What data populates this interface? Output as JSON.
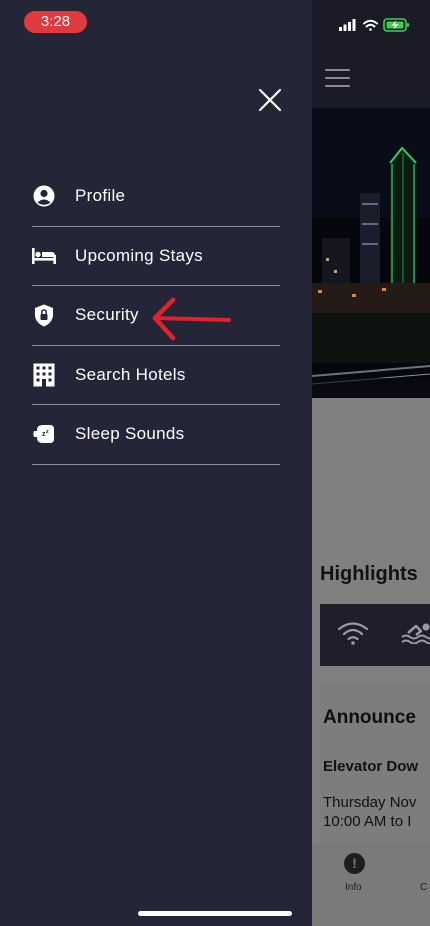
{
  "status_bar": {
    "time": "3:28"
  },
  "drawer": {
    "menu": [
      {
        "label": "Profile",
        "icon": "profile-icon"
      },
      {
        "label": "Upcoming Stays",
        "icon": "bed-icon"
      },
      {
        "label": "Security",
        "icon": "shield-lock-icon"
      },
      {
        "label": "Search Hotels",
        "icon": "building-icon"
      },
      {
        "label": "Sleep Sounds",
        "icon": "sleep-sounds-icon"
      }
    ],
    "close_icon": "close-icon"
  },
  "background_app": {
    "highlights_title": "Highlights",
    "announcements_title": "Announce",
    "announcement": {
      "title": "Elevator Dow",
      "date_line1": "Thursday Nov",
      "date_line2": "10:00 AM to I"
    },
    "tabs": [
      {
        "label": "Info",
        "icon": "info-icon"
      },
      {
        "label": "C"
      }
    ]
  },
  "colors": {
    "drawer_bg": "#252538",
    "time_pill": "#e0393e",
    "annotation_arrow": "#e3202d",
    "divider": "#8a8a9a"
  }
}
